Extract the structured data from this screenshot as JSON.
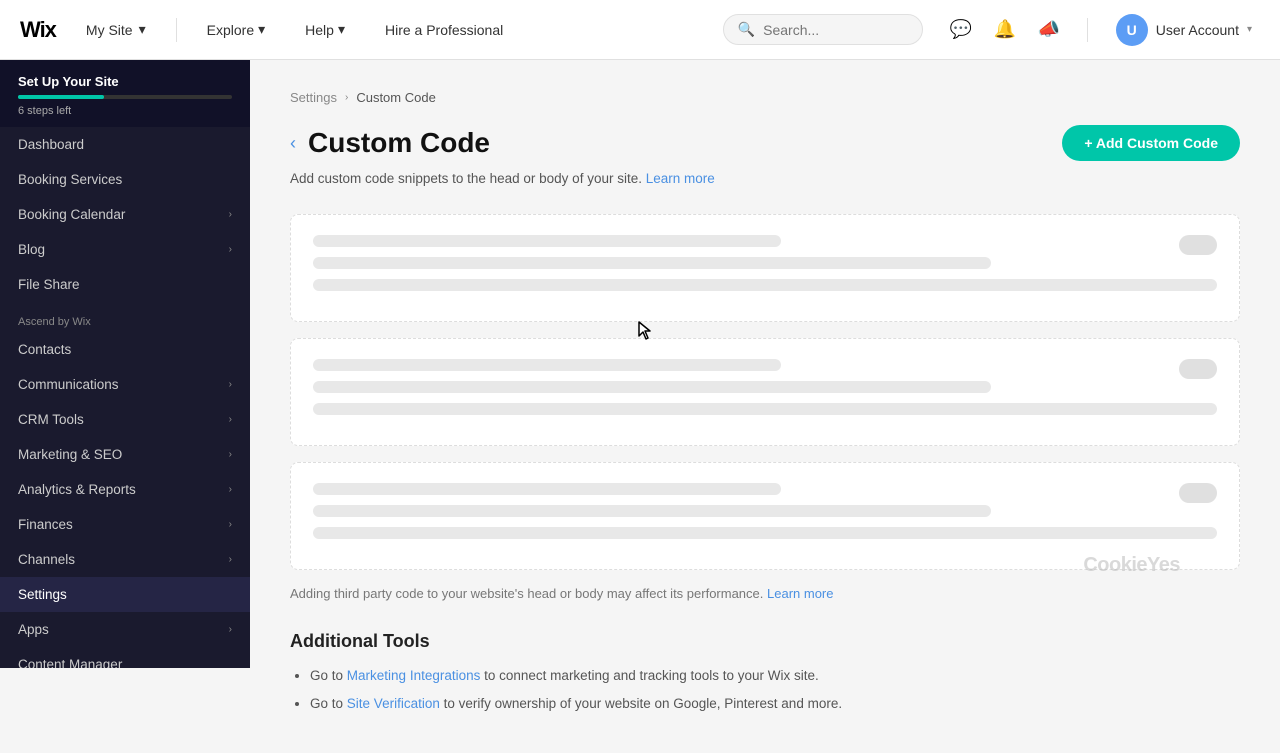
{
  "topnav": {
    "logo": "Wix",
    "my_site_label": "My Site",
    "explore_label": "Explore",
    "help_label": "Help",
    "hire_label": "Hire a Professional",
    "search_placeholder": "Search...",
    "user_account_label": "User Account"
  },
  "sidebar": {
    "setup": {
      "title": "Set Up Your Site",
      "steps_left": "6 steps left",
      "progress_pct": 40
    },
    "items": [
      {
        "id": "dashboard",
        "label": "Dashboard",
        "has_chevron": false
      },
      {
        "id": "booking-services",
        "label": "Booking Services",
        "has_chevron": false
      },
      {
        "id": "booking-calendar",
        "label": "Booking Calendar",
        "has_chevron": true
      },
      {
        "id": "blog",
        "label": "Blog",
        "has_chevron": true
      },
      {
        "id": "file-share",
        "label": "File Share",
        "has_chevron": false
      }
    ],
    "ascend_section_label": "Ascend by Wix",
    "ascend_items": [
      {
        "id": "contacts",
        "label": "Contacts",
        "has_chevron": false
      },
      {
        "id": "communications",
        "label": "Communications",
        "has_chevron": true
      },
      {
        "id": "crm-tools",
        "label": "CRM Tools",
        "has_chevron": true
      },
      {
        "id": "marketing-seo",
        "label": "Marketing & SEO",
        "has_chevron": true
      },
      {
        "id": "analytics-reports",
        "label": "Analytics & Reports",
        "has_chevron": true
      },
      {
        "id": "finances",
        "label": "Finances",
        "has_chevron": true
      }
    ],
    "bottom_items": [
      {
        "id": "channels",
        "label": "Channels",
        "has_chevron": true
      },
      {
        "id": "settings",
        "label": "Settings",
        "has_chevron": false,
        "active": true
      },
      {
        "id": "apps",
        "label": "Apps",
        "has_chevron": true
      },
      {
        "id": "content-manager",
        "label": "Content Manager",
        "has_chevron": false
      }
    ]
  },
  "breadcrumb": {
    "settings_label": "Settings",
    "current_label": "Custom Code"
  },
  "page": {
    "title": "Custom Code",
    "subtitle": "Add custom code snippets to the head or body of your site.",
    "learn_more_label": "Learn more",
    "add_button_label": "+ Add Custom Code",
    "bottom_info": "Adding third party code to your website's head or body may affect its performance.",
    "bottom_learn_more": "Learn more"
  },
  "additional_tools": {
    "title": "Additional Tools",
    "items": [
      {
        "prefix": "Go to",
        "link_text": "Marketing Integrations",
        "suffix": "to connect marketing and tracking tools to your Wix site."
      },
      {
        "prefix": "Go to",
        "link_text": "Site Verification",
        "suffix": "to verify ownership of your website on Google, Pinterest and more."
      }
    ]
  }
}
